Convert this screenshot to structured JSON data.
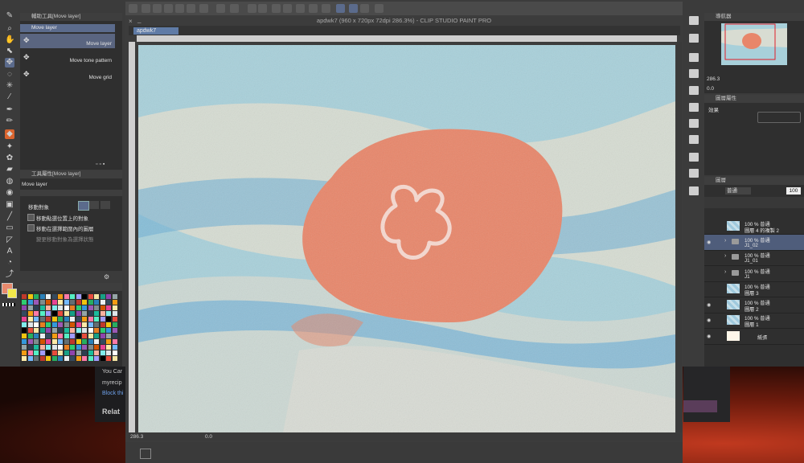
{
  "app": {
    "title": "apdwk7 (960 x 720px 72dpi 286.3%) - CLIP STUDIO PAINT PRO",
    "tab_name": "apdwk7",
    "close_glyph": "×",
    "minimize_glyph": "_"
  },
  "sub_tool_panel": {
    "title": "輔助工具[Move layer]",
    "group_label": "Move layer",
    "items": [
      {
        "label": "Move layer",
        "selected": true
      },
      {
        "label": "Move tone pattern",
        "selected": false
      },
      {
        "label": "Move grid",
        "selected": false
      }
    ]
  },
  "tool_property_panel": {
    "title": "工具屬性[Move layer]",
    "tool_name": "Move layer",
    "target_label": "移動對象",
    "options": [
      {
        "label": "移動點選位置上的對象",
        "checked": false,
        "enabled": true
      },
      {
        "label": "移動在選擇範圍內的圖層",
        "checked": false,
        "enabled": true
      },
      {
        "label": "變更移動對象為選擇狀態",
        "checked": false,
        "enabled": false
      }
    ]
  },
  "status_bar": {
    "zoom": "286.3",
    "angle": "0.0"
  },
  "navigator": {
    "title": "導航器",
    "zoom": "286.3",
    "angle": "0.0"
  },
  "layer_property": {
    "title": "圖層屬性",
    "effect_label": "效果"
  },
  "layer_panel": {
    "title": "圖層",
    "blend_mode": "普通",
    "opacity": "100",
    "layers": [
      {
        "line1": "100 % 普通",
        "line2": "圖層 4 的複製 2",
        "kind": "layer",
        "visible": false,
        "selected": false
      },
      {
        "line1": "100 % 普通",
        "line2": "J1_02",
        "kind": "folder",
        "visible": true,
        "selected": true
      },
      {
        "line1": "100 % 普通",
        "line2": "J1_01",
        "kind": "folder",
        "visible": false,
        "selected": false
      },
      {
        "line1": "100 % 普通",
        "line2": "J1",
        "kind": "folder",
        "visible": false,
        "selected": false
      },
      {
        "line1": "100 % 普通",
        "line2": "圖層 3",
        "kind": "layer",
        "visible": false,
        "selected": false
      },
      {
        "line1": "100 % 普通",
        "line2": "圖層 2",
        "kind": "layer",
        "visible": true,
        "selected": false
      },
      {
        "line1": "100 % 普通",
        "line2": "圖層 1",
        "kind": "layer",
        "visible": true,
        "selected": false
      },
      {
        "line1": "",
        "line2": "紙張",
        "kind": "paper",
        "visible": true,
        "selected": false
      }
    ]
  },
  "background_window": {
    "lines": [
      "You Car",
      "myrecip",
      "Block thi",
      "Relat"
    ]
  },
  "colors": {
    "main_color": "#e8896c",
    "sub_color": "#f2e94a",
    "jellyfish": "#e8866a",
    "accent": "#5b6b8c"
  },
  "icons": {
    "close": "close-icon",
    "move": "move-icon",
    "eye": "eye-icon",
    "folder": "folder-icon"
  }
}
